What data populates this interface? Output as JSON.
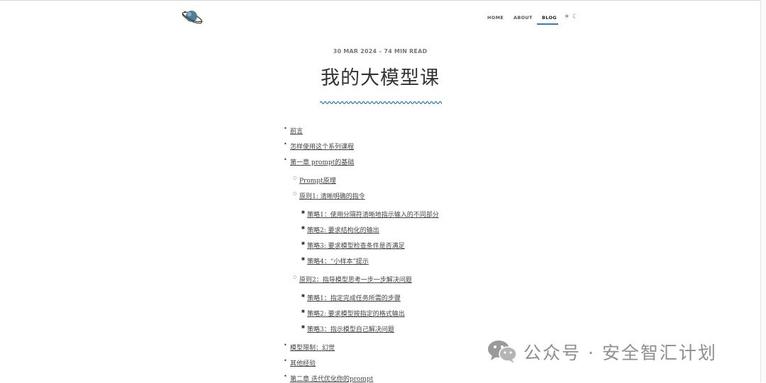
{
  "nav": {
    "items": [
      {
        "label": "HOME"
      },
      {
        "label": "ABOUT"
      },
      {
        "label": "BLOG"
      }
    ],
    "active": "BLOG",
    "mode_icons": {
      "light": "sun-icon",
      "dark": "moon-icon"
    }
  },
  "post": {
    "meta": "30 MAR 2024 – 74 MIN READ",
    "title": "我的大模型课"
  },
  "toc": [
    {
      "level": 1,
      "label": "前言"
    },
    {
      "level": 1,
      "label": "怎样使用这个系列课程"
    },
    {
      "level": 1,
      "label": "第一章 prompt的基础"
    },
    {
      "level": 2,
      "label": "Prompt原理"
    },
    {
      "level": 2,
      "label": "原则1: 清晰明确的指令"
    },
    {
      "level": 3,
      "label": "策略1：使用分隔符清晰地指示输入的不同部分"
    },
    {
      "level": 3,
      "label": "策略2: 要求结构化的输出"
    },
    {
      "level": 3,
      "label": "策略3: 要求模型检查条件是否满足"
    },
    {
      "level": 3,
      "label": "策略4：“小样本”提示"
    },
    {
      "level": 2,
      "label": "原则2：指导模型思考一步一步解决问题"
    },
    {
      "level": 3,
      "label": "策略1：指定完成任务所需的步骤"
    },
    {
      "level": 3,
      "label": "策略2: 要求模型按指定的格式输出"
    },
    {
      "level": 3,
      "label": "策略3：指示模型自己解决问题"
    },
    {
      "level": 1,
      "label": "模型限制：幻觉"
    },
    {
      "level": 1,
      "label": "其他经验"
    },
    {
      "level": 1,
      "label": "第二章 迭代优化你的prompt"
    }
  ],
  "watermark": {
    "icon": "wechat-icon",
    "text": "公众号 · 安全智汇计划"
  },
  "colors": {
    "accent": "#3d7ea6",
    "text": "#333333",
    "watermark": "#8f8f8f"
  }
}
